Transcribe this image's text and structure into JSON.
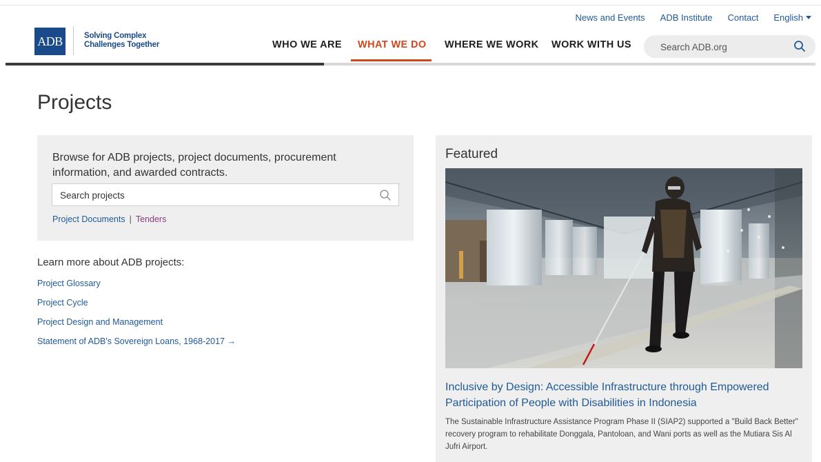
{
  "utility_nav": {
    "news_events": "News and Events",
    "institute": "ADB Institute",
    "contact": "Contact",
    "language": "English"
  },
  "logo": {
    "text": "ADB",
    "tagline_line1": "Solving Complex",
    "tagline_line2": "Challenges Together"
  },
  "main_nav": {
    "items": [
      "WHO WE ARE",
      "WHAT WE DO",
      "WHERE WE WORK",
      "WORK WITH US"
    ],
    "active": "WHAT WE DO"
  },
  "site_search": {
    "placeholder": "Search ADB.org",
    "icon": "search-icon"
  },
  "page": {
    "title": "Projects"
  },
  "browse": {
    "description": "Browse for ADB projects, project documents, procurement information, and awarded contracts.",
    "search_placeholder": "Search projects",
    "search_icon": "search-icon",
    "links": {
      "documents": "Project Documents",
      "separator": "|",
      "tenders": "Tenders"
    }
  },
  "learn_more": {
    "heading": "Learn more about ADB projects:",
    "links": [
      "Project Glossary",
      "Project Cycle",
      "Project Design and Management",
      "Statement of ADB's Sovereign Loans, 1968-2017 →"
    ]
  },
  "featured": {
    "label": "Featured",
    "headline": "Inclusive by Design: Accessible Infrastructure through Empowered Participation of People with Disabilities in Indonesia",
    "description": "The Sustainable Infrastructure Assistance Program Phase II (SIAP2) supported a \"Build Back Better\" recovery program to rehabilitate Donggala, Pantoloan, and Wani ports as well as the Mutiara Sis Al Jufri Airport."
  },
  "colors": {
    "brand_blue": "#1b4a8a",
    "link_blue": "#1f5a96",
    "active_orange": "#d2461c",
    "tenders_purple": "#8a3a7a",
    "panel_gray": "#efefef"
  }
}
